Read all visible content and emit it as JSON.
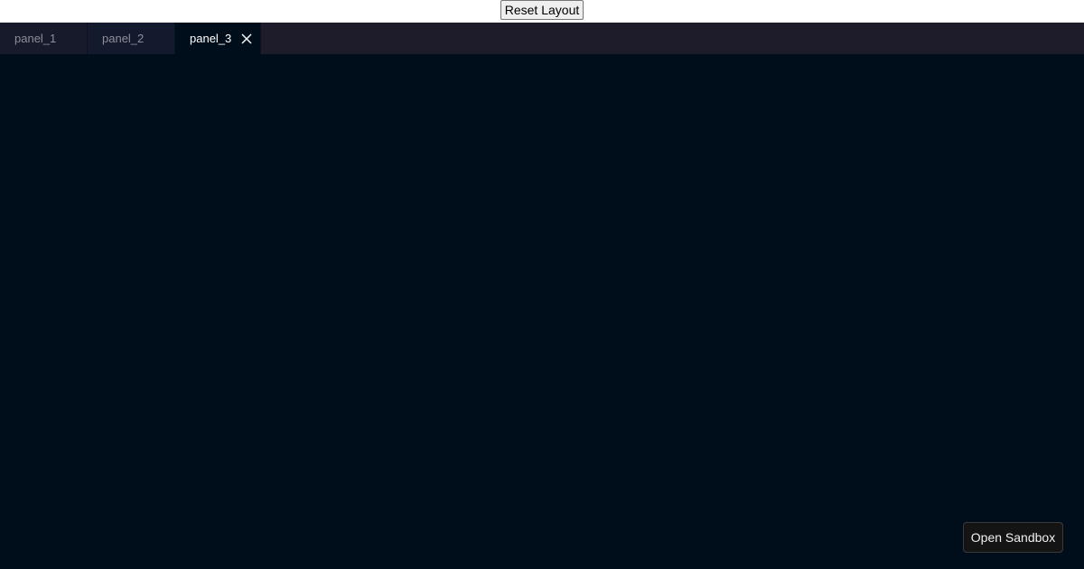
{
  "toolbar": {
    "reset_label": "Reset Layout"
  },
  "tabs": [
    {
      "label": "panel_1",
      "active": false
    },
    {
      "label": "panel_2",
      "active": false
    },
    {
      "label": "panel_3",
      "active": true,
      "close_icon": "close-icon"
    }
  ],
  "footer": {
    "sandbox_label": "Open Sandbox"
  },
  "colors": {
    "tabbar_bg": "#1e1c2a",
    "content_bg": "#000d1a",
    "active_tab_text": "#ffffff",
    "inactive_tab_text": "#8d8d9a"
  }
}
